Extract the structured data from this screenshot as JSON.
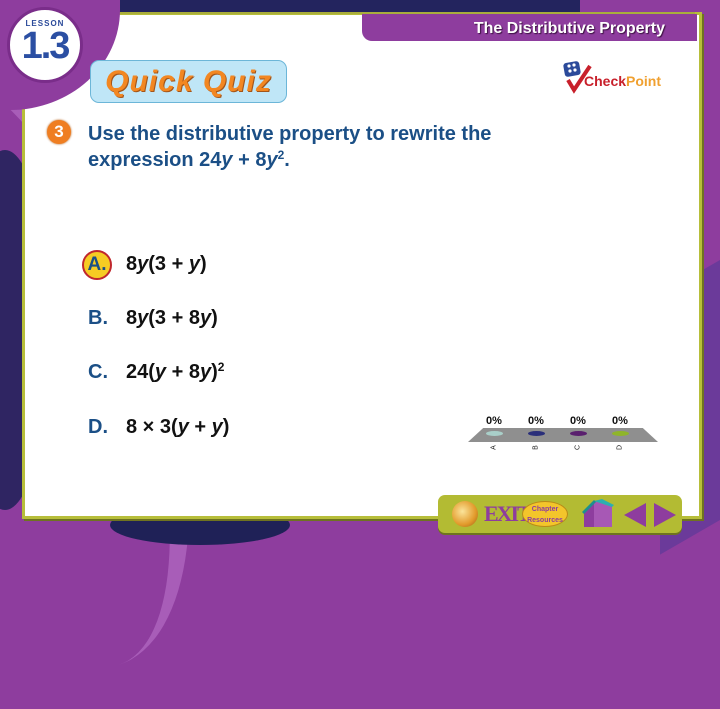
{
  "header": {
    "lesson_label": "LESSON",
    "lesson_number": "1.3",
    "title": "The Distributive Property",
    "quiz_badge": "Quick Quiz",
    "checkpoint_logo": {
      "part1": "Check",
      "part2": "Point"
    }
  },
  "question": {
    "number": "3",
    "text_line1": "Use the distributive property to rewrite the",
    "text_line2_prefix": "expression 24",
    "var": "y",
    "text_line2_mid": " + 8",
    "exponent": "2",
    "text_line2_end": "."
  },
  "choices": [
    {
      "letter": "A.",
      "parts": [
        "8",
        "y",
        "(3 + ",
        "y",
        ")"
      ],
      "sup": "",
      "correct": true
    },
    {
      "letter": "B.",
      "parts": [
        "8",
        "y",
        "(3 + 8",
        "y",
        ")"
      ],
      "sup": "",
      "correct": false
    },
    {
      "letter": "C.",
      "parts": [
        "24(",
        "y",
        " + 8",
        "y",
        ")"
      ],
      "sup": "2",
      "correct": false
    },
    {
      "letter": "D.",
      "parts": [
        "8 × 3(",
        "y",
        " + ",
        "y",
        ")"
      ],
      "sup": "",
      "correct": false
    }
  ],
  "poll": {
    "results": [
      {
        "label": "A",
        "percent": "0%",
        "color": "#a9cfc9"
      },
      {
        "label": "B",
        "percent": "0%",
        "color": "#2a2f7a"
      },
      {
        "label": "C",
        "percent": "0%",
        "color": "#5a1f6e"
      },
      {
        "label": "D",
        "percent": "0%",
        "color": "#8fb52a"
      }
    ]
  },
  "navbar": {
    "exit_label": "EXIT",
    "resources_label_1": "Chapter",
    "resources_label_2": "Resources"
  },
  "colors": {
    "brand_purple": "#8e3d9e",
    "question_blue": "#1b4f86",
    "quiz_orange": "#f28722",
    "border_olive": "#b7be3a"
  }
}
